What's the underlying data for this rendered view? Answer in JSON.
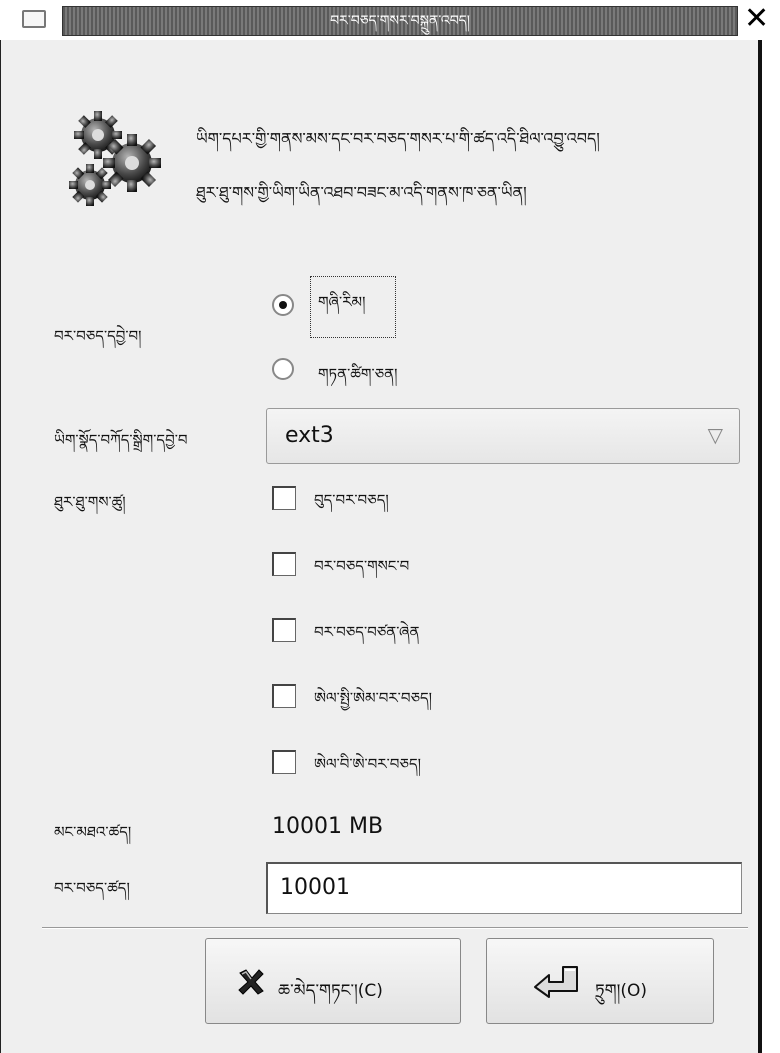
{
  "window": {
    "title": "བར་བཅད་གསར་བསྐྲུན་འབད།",
    "close_label": "✕"
  },
  "header": {
    "icon": "gears-icon",
    "line1": "ཡིག་དཔར་གྱི་གནས་མས་དང་བར་བཅད་གསར་པ་གི་ཚད་འདི་ཐིལ་འབྱུ་འབད།",
    "line2": "ཐུར་ཐུ་གས་གྱི་ཡིག་ཡིན་འཐབ་བཟང་མ་འདི་གནས་ཁ་ཅན་ཡིན།"
  },
  "partition_type": {
    "label": "བར་བཅད་དབྱེ་བ།",
    "options": [
      {
        "label": "གཞི་རིམ།",
        "selected": true
      },
      {
        "label": "གཏན་ཚིག་ཅན།",
        "selected": false
      }
    ]
  },
  "filesystem": {
    "label": "ཡིག་སྣོད་བཀོད་སྒྲིག་དབྱེ་བ",
    "value": "ext3",
    "arrow": "▽"
  },
  "flags": {
    "label": "ཐུར་ཐུ་གས་ཚུ།",
    "items": [
      {
        "label": "བུད་བར་བཅད།",
        "checked": false
      },
      {
        "label": "བར་བཅད་གསང་བ",
        "checked": false
      },
      {
        "label": "བར་བཅད་བཙན་ཞེན",
        "checked": false
      },
      {
        "label": "ཨེལ་སྤྱི་ཨེམ་བར་བཅད།",
        "checked": false
      },
      {
        "label": "ཨེལ་བི་ཨེ་བར་བཅད།",
        "checked": false
      }
    ]
  },
  "max_size": {
    "label": "མང་མཐའ་ཚད།",
    "value": "10001 MB"
  },
  "size": {
    "label": "བར་བཅད་ཚད།",
    "value": "10001"
  },
  "buttons": {
    "cancel_label": "ཆ་མེད་གཏང་།(C)",
    "ok_label": "ཏྲུག།(O)"
  }
}
